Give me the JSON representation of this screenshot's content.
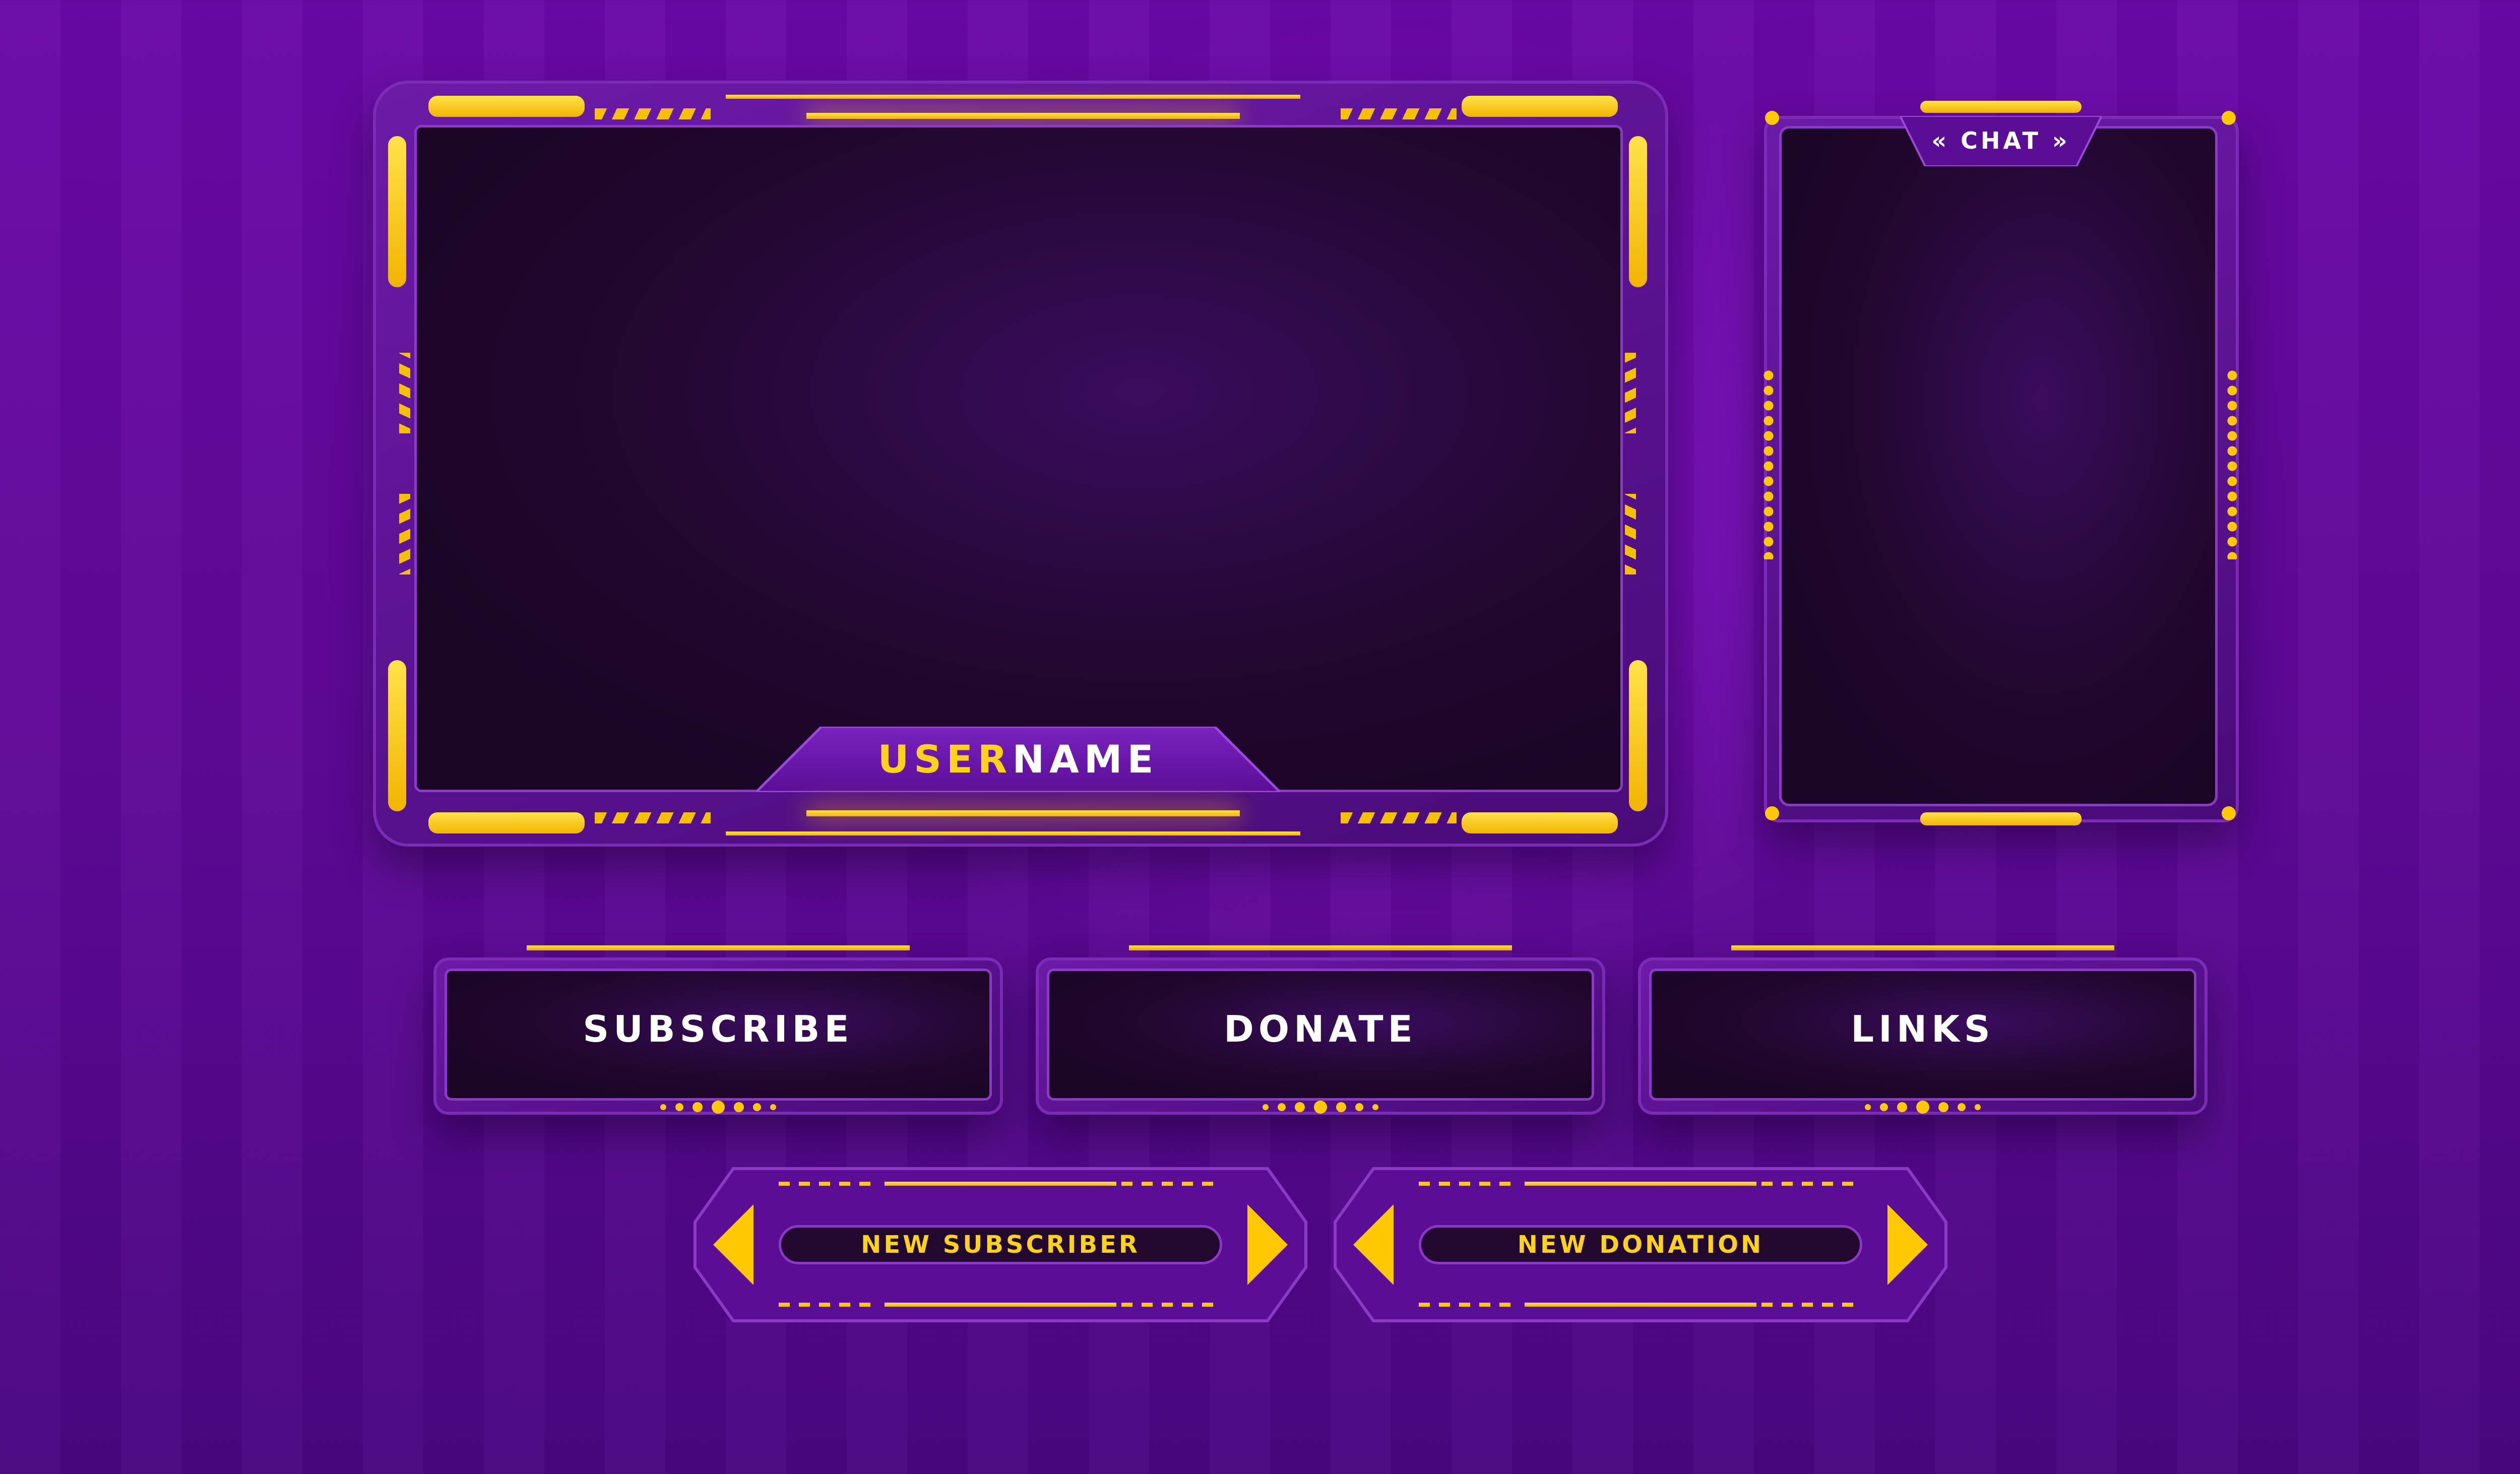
{
  "overlay": {
    "main_screen": {
      "username_part1": "USER",
      "username_part2": "NAME"
    },
    "chat": {
      "label": "CHAT",
      "left_chevrons": "«",
      "right_chevrons": "»"
    },
    "panels": [
      {
        "label": "SUBSCRIBE"
      },
      {
        "label": "DONATE"
      },
      {
        "label": "LINKS"
      }
    ],
    "alerts": [
      {
        "label": "NEW SUBSCRIBER"
      },
      {
        "label": "NEW DONATION"
      }
    ]
  },
  "colors": {
    "accent": "#ffc800",
    "background": "#6a08a6",
    "screen": "#22072f",
    "frame": "#5a1090"
  }
}
